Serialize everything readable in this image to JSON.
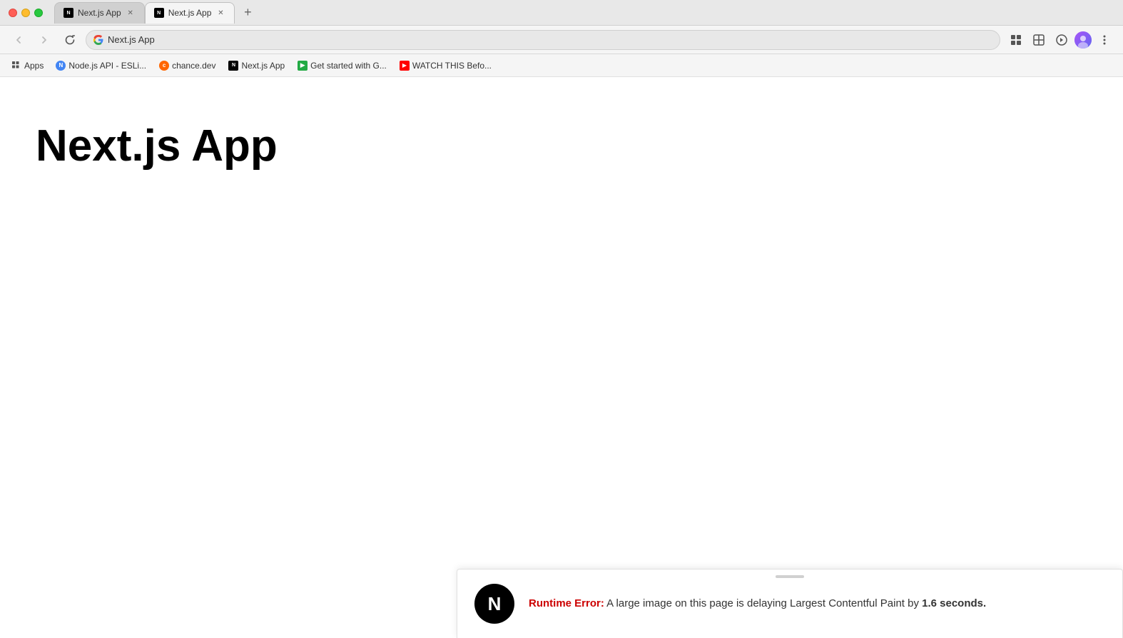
{
  "browser": {
    "tabs": [
      {
        "id": "tab1",
        "label": "Next.js App",
        "favicon": "next",
        "active": false
      },
      {
        "id": "tab2",
        "label": "Next.js App",
        "favicon": "next",
        "active": true
      }
    ],
    "address": "Next.js App",
    "address_url": "Next.js App"
  },
  "bookmarks": {
    "apps_label": "Apps",
    "items": [
      {
        "id": "bm1",
        "label": "Node.js API - ESLi...",
        "favicon": "blue"
      },
      {
        "id": "bm2",
        "label": "chance.dev",
        "favicon": "orange"
      },
      {
        "id": "bm3",
        "label": "Next.js App",
        "favicon": "next"
      },
      {
        "id": "bm4",
        "label": "Get started with G...",
        "favicon": "arrow"
      },
      {
        "id": "bm5",
        "label": "WATCH THIS Befo...",
        "favicon": "yt"
      }
    ]
  },
  "page": {
    "heading": "Next.js App"
  },
  "error": {
    "label": "Runtime Error:",
    "message": " A large image on this page is delaying Largest Contentful Paint by ",
    "bold_part": "1.6 seconds.",
    "icon": "N"
  }
}
